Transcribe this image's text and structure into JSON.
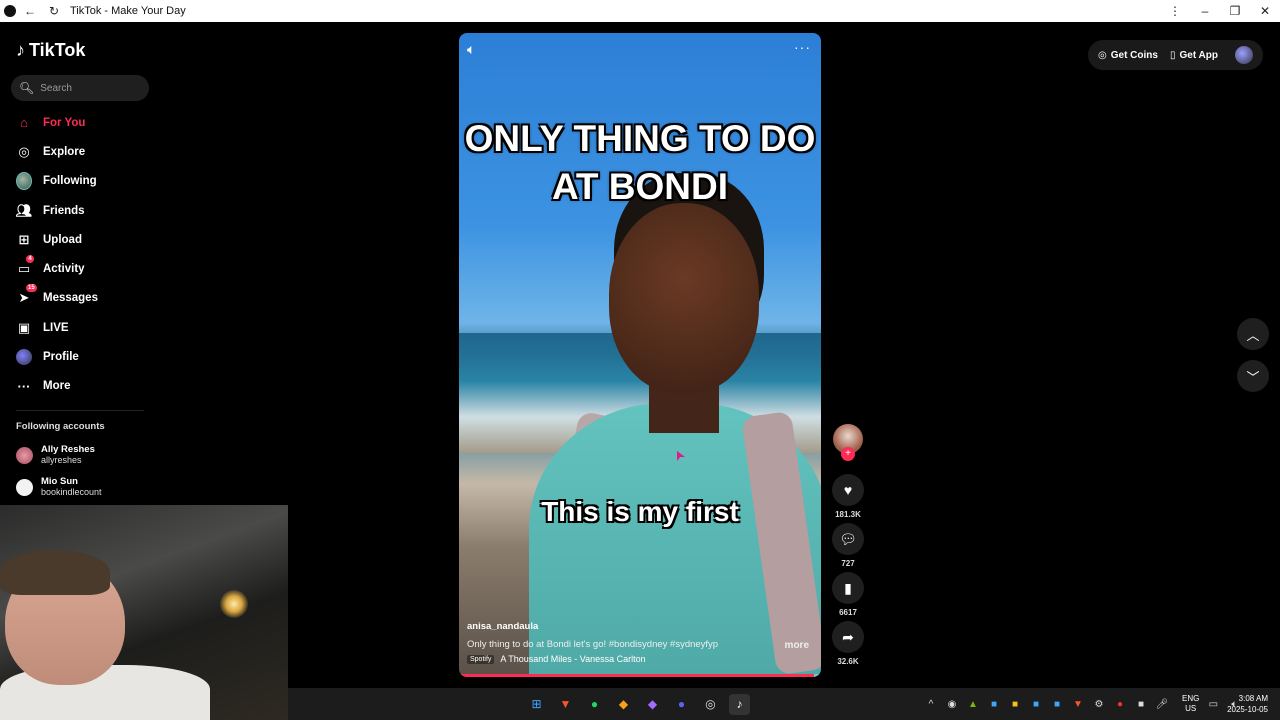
{
  "window": {
    "title": "TikTok - Make Your Day"
  },
  "brand": {
    "name": "TikTok",
    "accent": "#fe2c55"
  },
  "search": {
    "placeholder": "Search"
  },
  "nav": [
    {
      "label": "For You",
      "icon": "home-icon",
      "active": true
    },
    {
      "label": "Explore",
      "icon": "compass-icon"
    },
    {
      "label": "Following",
      "icon": "following-avatar"
    },
    {
      "label": "Friends",
      "icon": "friends-icon"
    },
    {
      "label": "Upload",
      "icon": "upload-icon"
    },
    {
      "label": "Activity",
      "icon": "activity-icon",
      "badge": "4"
    },
    {
      "label": "Messages",
      "icon": "messages-icon",
      "badge": "15"
    },
    {
      "label": "LIVE",
      "icon": "live-icon"
    },
    {
      "label": "Profile",
      "icon": "profile-avatar"
    },
    {
      "label": "More",
      "icon": "more-icon"
    }
  ],
  "following": {
    "title": "Following accounts",
    "accounts": [
      {
        "name": "Ally Reshes",
        "handle": "allyreshes"
      },
      {
        "name": "Mio Sun",
        "handle": "bookindlecount"
      }
    ]
  },
  "video": {
    "caption_top": "ONLY THING TO DO AT BONDI",
    "caption_mid": "This is my first",
    "author": "anisa_nandaula",
    "description": "Only thing to do at Bondi let's go! #bondisydney  #sydneyfyp",
    "more_label": "more",
    "music_source": "Spotify",
    "music": "A Thousand Miles - Vanessa Carlton",
    "progress": 0.98
  },
  "actions": {
    "likes": "181.3K",
    "comments": "727",
    "saves": "6617",
    "shares": "32.6K"
  },
  "topbar": {
    "coins_label": "Get Coins",
    "app_label": "Get App"
  },
  "taskbar": {
    "lang_1": "ENG",
    "lang_2": "US",
    "time": "3:08 AM",
    "date": "2025-10-05"
  }
}
